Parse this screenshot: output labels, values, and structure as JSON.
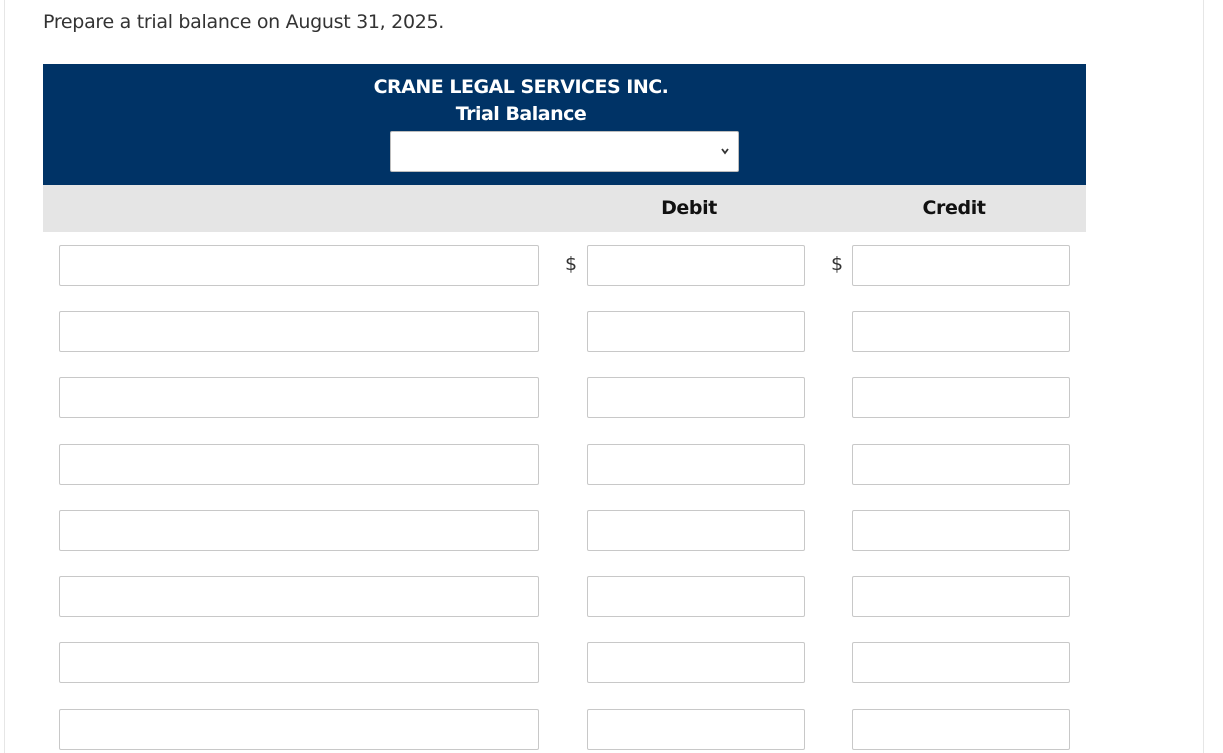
{
  "instruction": "Prepare a trial balance on August 31, 2025.",
  "statement": {
    "company": "CRANE LEGAL SERVICES INC.",
    "title": "Trial Balance",
    "date_select": {
      "selected": ""
    }
  },
  "columns": {
    "debit": "Debit",
    "credit": "Credit"
  },
  "currency_symbol": "$",
  "rows": [
    {
      "account": "",
      "debit": "",
      "credit": "",
      "show_dollar": true
    },
    {
      "account": "",
      "debit": "",
      "credit": "",
      "show_dollar": false
    },
    {
      "account": "",
      "debit": "",
      "credit": "",
      "show_dollar": false
    },
    {
      "account": "",
      "debit": "",
      "credit": "",
      "show_dollar": false
    },
    {
      "account": "",
      "debit": "",
      "credit": "",
      "show_dollar": false
    },
    {
      "account": "",
      "debit": "",
      "credit": "",
      "show_dollar": false
    },
    {
      "account": "",
      "debit": "",
      "credit": "",
      "show_dollar": false
    },
    {
      "account": "",
      "debit": "",
      "credit": "",
      "show_dollar": false
    }
  ],
  "colors": {
    "header_bg": "#003366",
    "column_header_bg": "#e5e5e5"
  }
}
